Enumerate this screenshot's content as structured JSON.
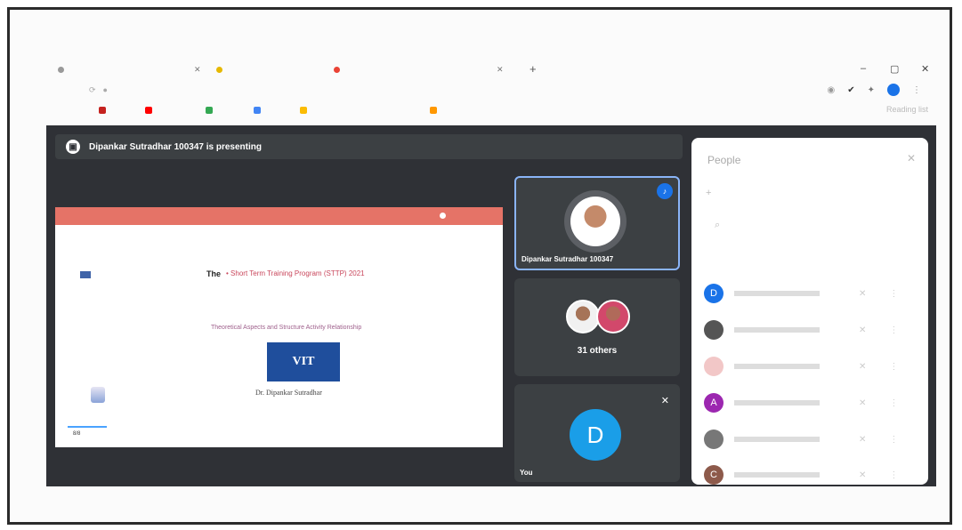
{
  "browser": {
    "tab_new_label": "+",
    "window_minimize": "–",
    "window_restore": "▢",
    "window_close": "✕",
    "tab_close": "✕",
    "bookmarks_other": "Reading list"
  },
  "meet": {
    "presenting_banner": "Dipankar Sutradhar 100347 is presenting",
    "speaker_tile_name": "Dipankar Sutradhar 100347",
    "others_label": "31 others",
    "you_initial": "D",
    "you_label": "You"
  },
  "slide": {
    "title_prefix": "The",
    "title_rest": "• Short Term Training Program (STTP) 2021",
    "subtitle": "Theoretical Aspects and Structure Activity Relationship",
    "logo_text": "VIT",
    "presenter": "Dr. Dipankar Sutradhar",
    "page": "8/8"
  },
  "people_panel": {
    "title": "People",
    "close": "✕",
    "add_icon": "+",
    "search_icon": "⌕",
    "participants": [
      {
        "initial": "D",
        "color": "#1a73e8"
      },
      {
        "initial": "",
        "color": "#555555"
      },
      {
        "initial": "",
        "color": "#f2c7c7"
      },
      {
        "initial": "A",
        "color": "#9c27b0"
      },
      {
        "initial": "",
        "color": "#777777"
      },
      {
        "initial": "C",
        "color": "#8d5a4b"
      }
    ]
  },
  "colors": {
    "meet_bg": "#2f3136",
    "accent": "#1a73e8",
    "slide_header": "#e57367"
  }
}
